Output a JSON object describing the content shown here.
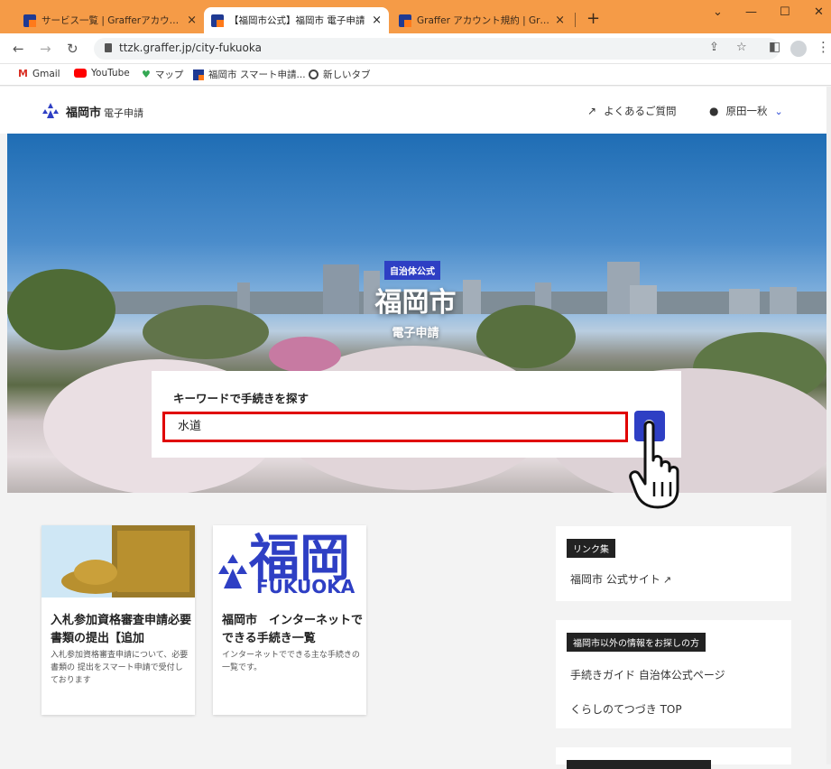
{
  "browser": {
    "tabs": [
      {
        "title": "サービス一覧 | Grafferアカウント",
        "close": "×"
      },
      {
        "title": "【福岡市公式】福岡市 電子申請",
        "close": "×"
      },
      {
        "title": "Graffer アカウント規約 | Graffer, Inc.",
        "close": "×"
      }
    ],
    "new_tab": "+",
    "url": "ttzk.graffer.jp/city-fukuoka",
    "bookmarks": [
      {
        "label": "Gmail",
        "icon": "gmail-icon"
      },
      {
        "label": "YouTube",
        "icon": "youtube-icon"
      },
      {
        "label": "マップ",
        "icon": "maps-icon"
      },
      {
        "label": "福岡市 スマート申請...",
        "icon": "graffer-icon"
      },
      {
        "label": "新しいタブ",
        "icon": "globe-icon"
      }
    ]
  },
  "header": {
    "brand": "福岡市",
    "brand_sub": "電子申請",
    "faq": "よくあるご質問",
    "user": "原田一秋"
  },
  "hero": {
    "badge": "自治体公式",
    "title": "福岡市",
    "subtitle": "電子申請"
  },
  "search": {
    "label": "キーワードで手続きを探す",
    "value": "水道"
  },
  "cards": [
    {
      "title": "入札参加資格審査申請必要書類の提出【追加",
      "desc": "入札参加資格審査申請について、必要書類の 提出をスマート申請で受付しております"
    },
    {
      "title": "福岡市　インターネットでできる手続き一覧",
      "desc": "インターネットでできる主な手続きの一覧です。",
      "img_text_1": "福岡",
      "img_text_2": "FUKUOKA"
    }
  ],
  "sidebar": {
    "links_tag": "リンク集",
    "links": [
      {
        "label": "福岡市 公式サイト"
      }
    ],
    "other_tag": "福岡市以外の情報をお探しの方",
    "other_links": [
      {
        "label": "手続きガイド 自治体公式ページ"
      },
      {
        "label": "くらしのてつづき TOP"
      }
    ]
  },
  "colors": {
    "tabstrip": "#f59b47",
    "accent": "#2e3fc4",
    "highlight": "#e00000"
  }
}
